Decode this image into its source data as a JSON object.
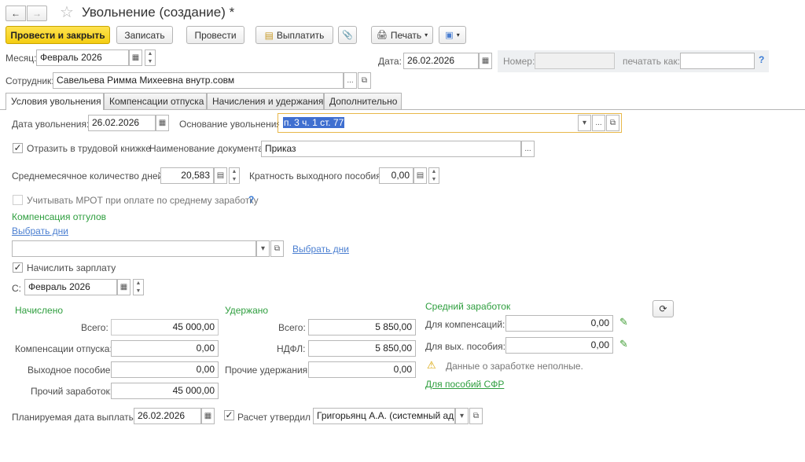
{
  "window": {
    "title": "Увольнение (создание) *",
    "back_icon": "←",
    "forward_icon": "→",
    "star_icon": "☆"
  },
  "toolbar": {
    "post_close": "Провести и закрыть",
    "save": "Записать",
    "post": "Провести",
    "pay": "Выплатить",
    "print": "Печать",
    "print_icon": "🖨",
    "pay_icon": "▤",
    "clip_icon": "📎",
    "more_icon": "▾"
  },
  "header": {
    "month_label": "Месяц:",
    "month_value": "Февраль 2026",
    "date_label": "Дата:",
    "date_value": "26.02.2026",
    "number_label": "Номер:",
    "number_value": "",
    "print_as_label": "печатать как:",
    "print_as_value": "",
    "help": "?",
    "employee_label": "Сотрудник:",
    "employee_value": "Савельева Римма Михеевна внутр.совм"
  },
  "tabs": [
    {
      "label": "Условия увольнения"
    },
    {
      "label": "Компенсации отпуска"
    },
    {
      "label": "Начисления и удержания"
    },
    {
      "label": "Дополнительно"
    }
  ],
  "conditions": {
    "dismissal_date_label": "Дата увольнения:",
    "dismissal_date_value": "26.02.2026",
    "basis_label": "Основание увольнения:",
    "basis_value": "п. 3 ч. 1 ст. 77",
    "reflect_label": "Отразить в трудовой книжке",
    "reflect_checked": true,
    "doc_name_label": "Наименование документа:",
    "doc_name_value": "Приказ",
    "avg_days_label": "Среднемесячное количество дней:",
    "avg_days_value": "20,583",
    "multiplicity_label": "Кратность выходного пособия:",
    "multiplicity_value": "0,00",
    "mrot_label": "Учитывать МРОТ при оплате по среднему заработку",
    "mrot_help": "?",
    "mrot_checked": false,
    "comp_title": "Компенсация отгулов",
    "select_days_link": "Выбрать дни",
    "select_days_link2": "Выбрать дни",
    "comp_value": "",
    "accrue_label": "Начислить зарплату",
    "accrue_checked": true,
    "from_label": "С:",
    "from_value": "Февраль 2026"
  },
  "accrued": {
    "title": "Начислено",
    "total_label": "Всего:",
    "total": "45 000,00",
    "vacation_label": "Компенсации отпуска:",
    "vacation": "0,00",
    "severance_label": "Выходное пособие:",
    "severance": "0,00",
    "other_label": "Прочий заработок:",
    "other": "45 000,00"
  },
  "withheld": {
    "title": "Удержано",
    "total_label": "Всего:",
    "total": "5 850,00",
    "ndfl_label": "НДФЛ:",
    "ndfl": "5 850,00",
    "other_label": "Прочие удержания:",
    "other": "0,00"
  },
  "average": {
    "title": "Средний заработок",
    "comp_label": "Для компенсаций:",
    "comp": "0,00",
    "sev_label": "Для вых. пособия:",
    "sev": "0,00",
    "warning": "Данные о заработке неполные.",
    "sfr_link": "Для пособий СФР"
  },
  "footer": {
    "pay_date_label": "Планируемая дата выплаты:",
    "pay_date_value": "26.02.2026",
    "approved_label": "Расчет утвердил",
    "approved_checked": true,
    "approved_value": "Григорьянц А.А. (системный адми"
  },
  "colors": {
    "accent_yellow": "#f4cd12",
    "section_green": "#2e9e3e",
    "link_blue": "#4b7fd1",
    "basis_border": "#e8b84a"
  }
}
